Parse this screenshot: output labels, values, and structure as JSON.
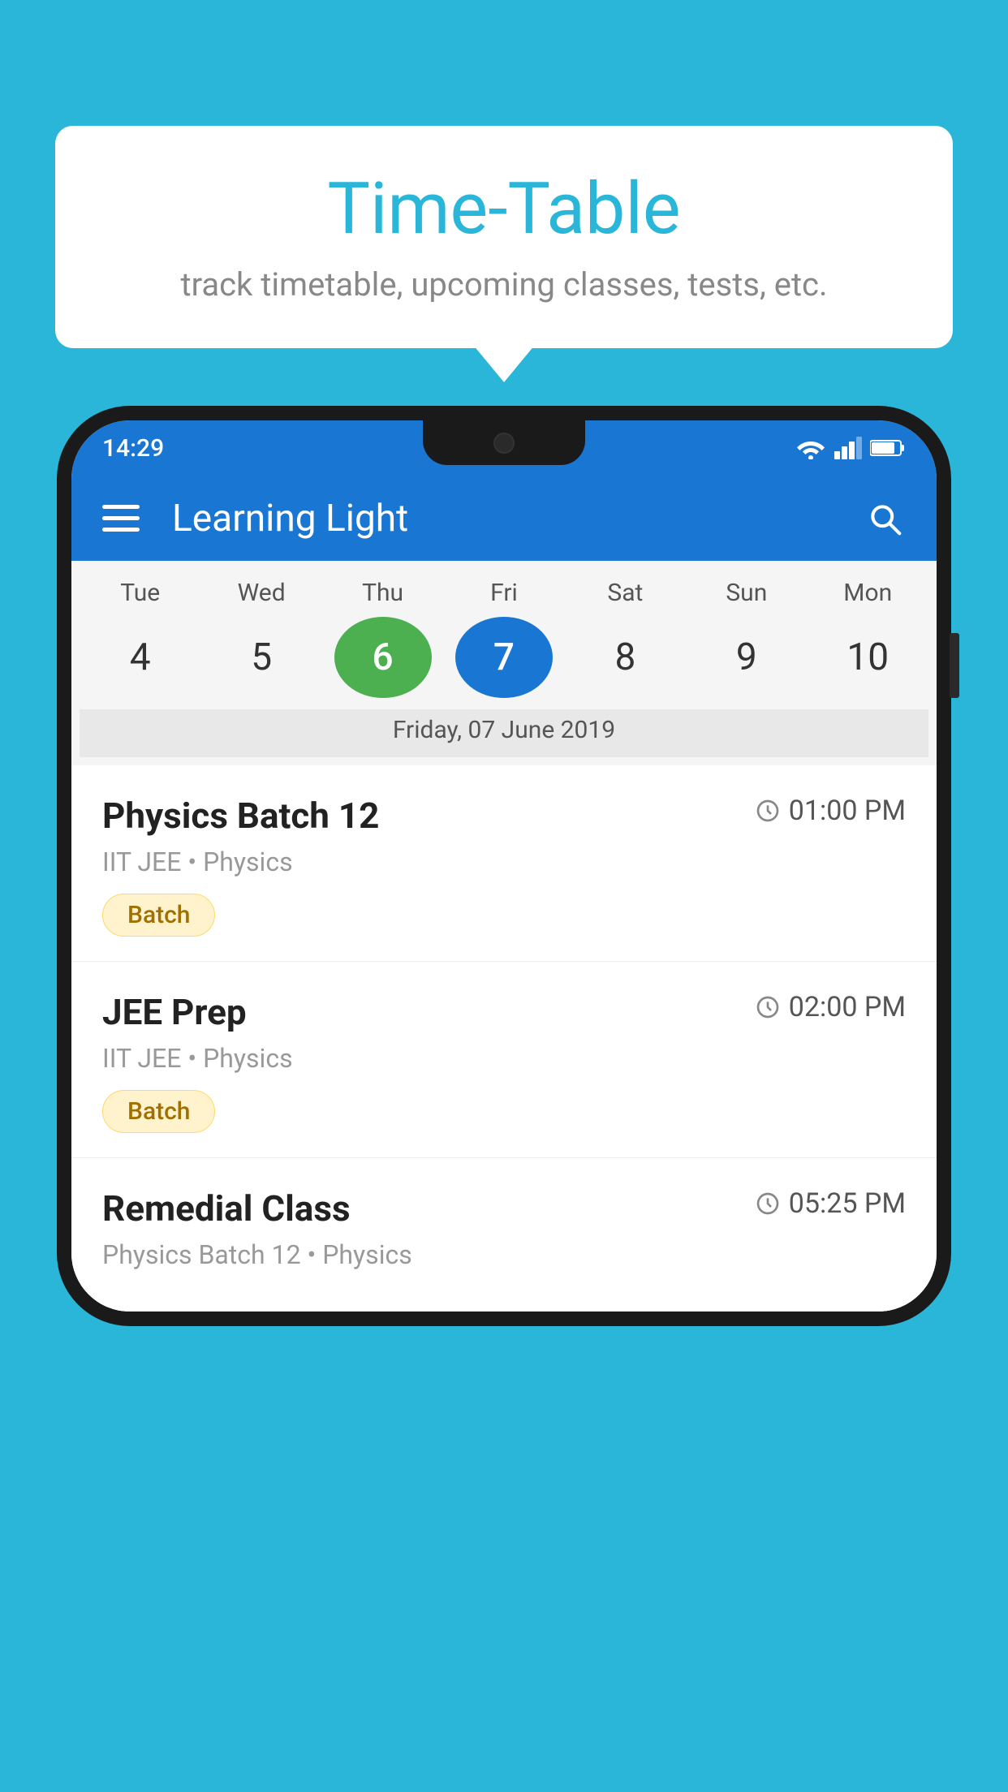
{
  "background_color": "#29B6D8",
  "speech_bubble": {
    "title": "Time-Table",
    "subtitle": "track timetable, upcoming classes, tests, etc."
  },
  "phone": {
    "status_bar": {
      "time": "14:29"
    },
    "app_bar": {
      "title": "Learning Light"
    },
    "calendar": {
      "days": [
        "Tue",
        "Wed",
        "Thu",
        "Fri",
        "Sat",
        "Sun",
        "Mon"
      ],
      "dates": [
        "4",
        "5",
        "6",
        "7",
        "8",
        "9",
        "10"
      ],
      "today_index": 2,
      "selected_index": 3,
      "selected_label": "Friday, 07 June 2019"
    },
    "schedule": [
      {
        "title": "Physics Batch 12",
        "time": "01:00 PM",
        "subtitle": "IIT JEE • Physics",
        "badge": "Batch"
      },
      {
        "title": "JEE Prep",
        "time": "02:00 PM",
        "subtitle": "IIT JEE • Physics",
        "badge": "Batch"
      },
      {
        "title": "Remedial Class",
        "time": "05:25 PM",
        "subtitle": "Physics Batch 12 • Physics",
        "badge": null
      }
    ]
  }
}
